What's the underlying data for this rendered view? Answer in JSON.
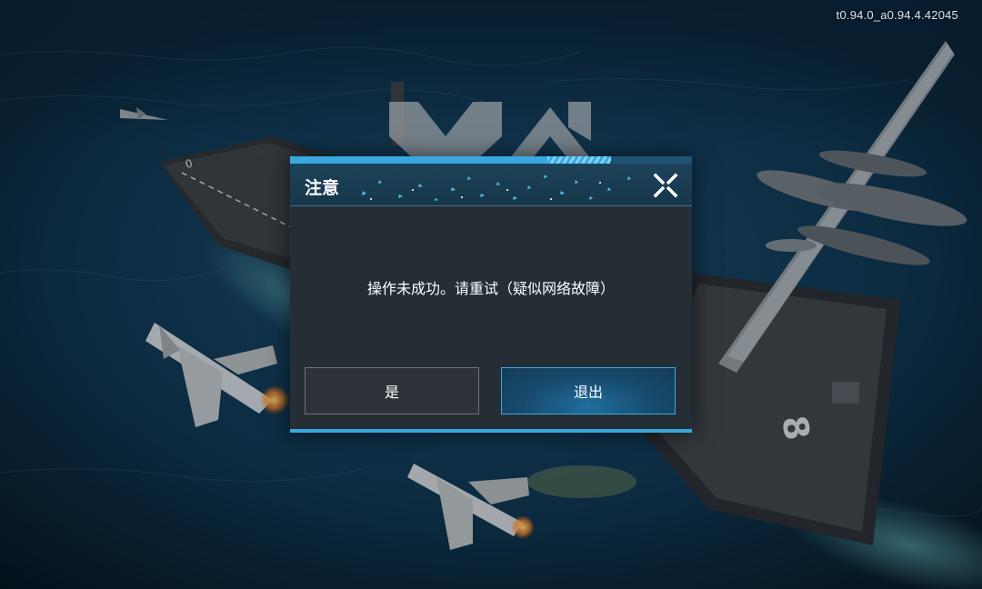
{
  "version": "t0.94.0_a0.94.4.42045",
  "dialog": {
    "title": "注意",
    "message": "操作未成功。请重试（疑似网络故障）",
    "confirm_label": "是",
    "exit_label": "退出",
    "close_icon": "close-icon"
  },
  "theme": {
    "accent": "#3aa8e0",
    "dialog_bg": "#262e35",
    "header_bg": "#1d4259",
    "sea": "#0f3550"
  }
}
